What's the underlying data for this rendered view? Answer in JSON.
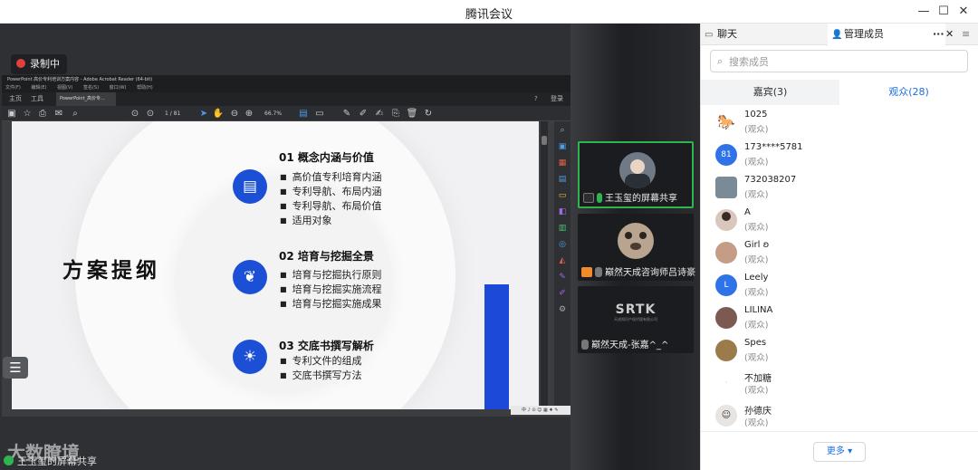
{
  "window": {
    "title": "腾讯会议",
    "controls": [
      "—",
      "☐",
      "✕"
    ]
  },
  "recording": {
    "label": "录制中"
  },
  "reader": {
    "titlebar": "PowerPoint  高价专利培训方案内容  -  Adobe Acrobat Reader (64-bit)",
    "menu": [
      "文件(F)",
      "编辑(E)",
      "视图(V)",
      "签名(S)",
      "窗口(W)",
      "帮助(H)"
    ],
    "tabs": {
      "home": "主页",
      "tools": "工具",
      "doc": "PowerPoint_高价专..."
    },
    "login": "登录",
    "page": "1 / 81",
    "zoom": "66.7%",
    "status": "中 ♪ ⊙ ☺ ▦ ♦ ✎"
  },
  "slide": {
    "title": "方案提纲",
    "sections": [
      {
        "head": "01  概念内涵与价值",
        "items": [
          "高价值专利培育内涵",
          "专利导航、布局内涵",
          "专利导航、布局价值",
          "适用对象"
        ]
      },
      {
        "head": "02  培育与挖掘全景",
        "items": [
          "培育与挖掘执行原则",
          "培育与挖掘实施流程",
          "培育与挖掘实施成果"
        ]
      },
      {
        "head": "03  交底书撰写解析",
        "items": [
          "专利文件的组成",
          "交底书撰写方法"
        ]
      }
    ]
  },
  "share": {
    "label": "王玉玺的屏幕共享",
    "watermark": "大数瞭境"
  },
  "tiles": [
    {
      "caption": "王玉玺的屏幕共享"
    },
    {
      "caption": "巅然天成咨询师吕诗豪"
    },
    {
      "caption": "巅然天成-张嘉^_^",
      "logo": "SRTK",
      "logo_sub": "天成知识产权代理有限公司"
    }
  ],
  "panel": {
    "tab_chat": "聊天",
    "tab_members": "管理成员",
    "more_menu": "···",
    "search_placeholder": "搜索成员",
    "seg_guests": "嘉宾(3)",
    "seg_audience": "观众(28)",
    "members": [
      {
        "name": "1025",
        "role": "(观众)",
        "avatar": "",
        "color": "#ffffff"
      },
      {
        "name": "173****5781",
        "role": "(观众)",
        "avatar": "81",
        "color": "#2f73e8"
      },
      {
        "name": "732038207",
        "role": "(观众)",
        "avatar": "",
        "color": "#7b8a97"
      },
      {
        "name": "A",
        "role": "(观众)",
        "avatar": "",
        "color": "#d9c7bd"
      },
      {
        "name": "Girl ʚ",
        "role": "(观众)",
        "avatar": "",
        "color": "#c59c86"
      },
      {
        "name": "Leely",
        "role": "(观众)",
        "avatar": "L",
        "color": "#2f73e8"
      },
      {
        "name": "LILINA",
        "role": "(观众)",
        "avatar": "",
        "color": "#7c5a52"
      },
      {
        "name": "Spes",
        "role": "(观众)",
        "avatar": "",
        "color": "#9b7a4c"
      },
      {
        "name": "不加糖",
        "role": "(观众)",
        "avatar": "",
        "color": "#ffffff"
      },
      {
        "name": "孙德庆",
        "role": "(观众)",
        "avatar": "",
        "color": "#e8e4e2"
      }
    ],
    "more_button": "更多 ▾"
  }
}
